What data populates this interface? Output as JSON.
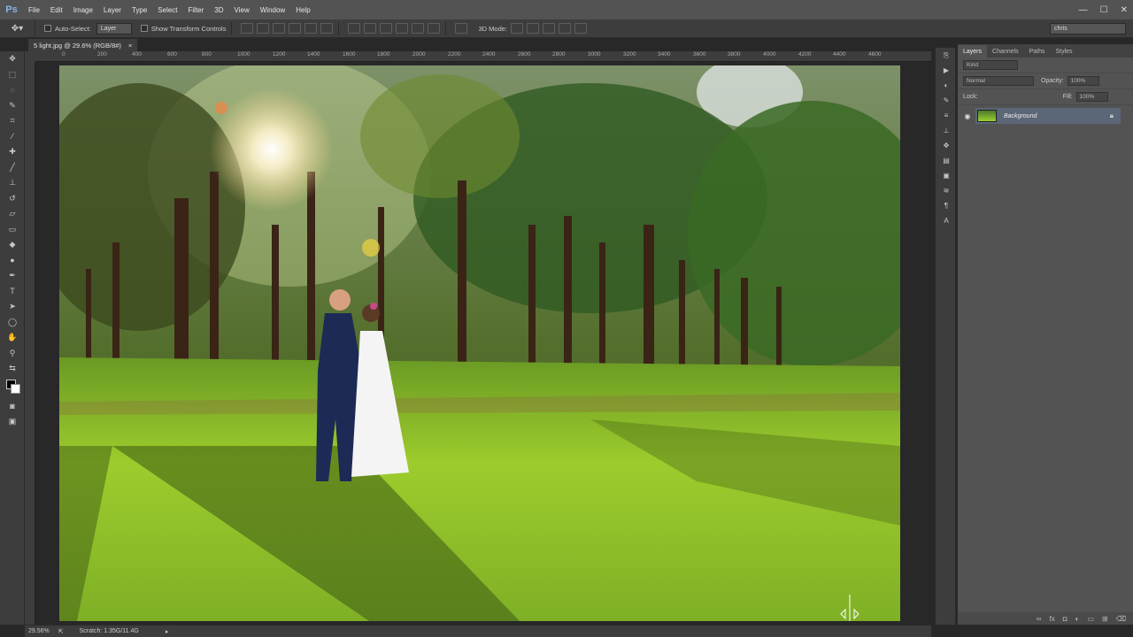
{
  "app": {
    "logo": "Ps"
  },
  "menu": [
    "File",
    "Edit",
    "Image",
    "Layer",
    "Type",
    "Select",
    "Filter",
    "3D",
    "View",
    "Window",
    "Help"
  ],
  "window_controls": {
    "minimize": "—",
    "maximize": "☐",
    "close": "✕"
  },
  "options": {
    "auto_select_label": "Auto-Select:",
    "auto_select_value": "Layer",
    "transform_label": "Show Transform Controls",
    "mode_3d_label": "3D Mode:",
    "user": "chris"
  },
  "document": {
    "tab_title": "5 light.jpg @ 29.6% (RGB/8#)",
    "close": "×"
  },
  "ruler_top": [
    "0",
    "200",
    "400",
    "600",
    "800",
    "1000",
    "1200",
    "1400",
    "1600",
    "1800",
    "2000",
    "2200",
    "2400",
    "2600",
    "2800",
    "3000",
    "3200",
    "3400",
    "3600",
    "3800",
    "4000",
    "4200",
    "4400",
    "4600"
  ],
  "layers_panel": {
    "tabs": [
      "Layers",
      "Channels",
      "Paths",
      "Styles"
    ],
    "kind_label": "Kind",
    "blend_mode": "Normal",
    "opacity_label": "Opacity:",
    "opacity_value": "100%",
    "lock_label": "Lock:",
    "fill_label": "Fill:",
    "fill_value": "100%",
    "layer_name": "Background"
  },
  "status": {
    "zoom": "29.56%",
    "scratch": "Scratch: 1.35G/11.4G"
  }
}
